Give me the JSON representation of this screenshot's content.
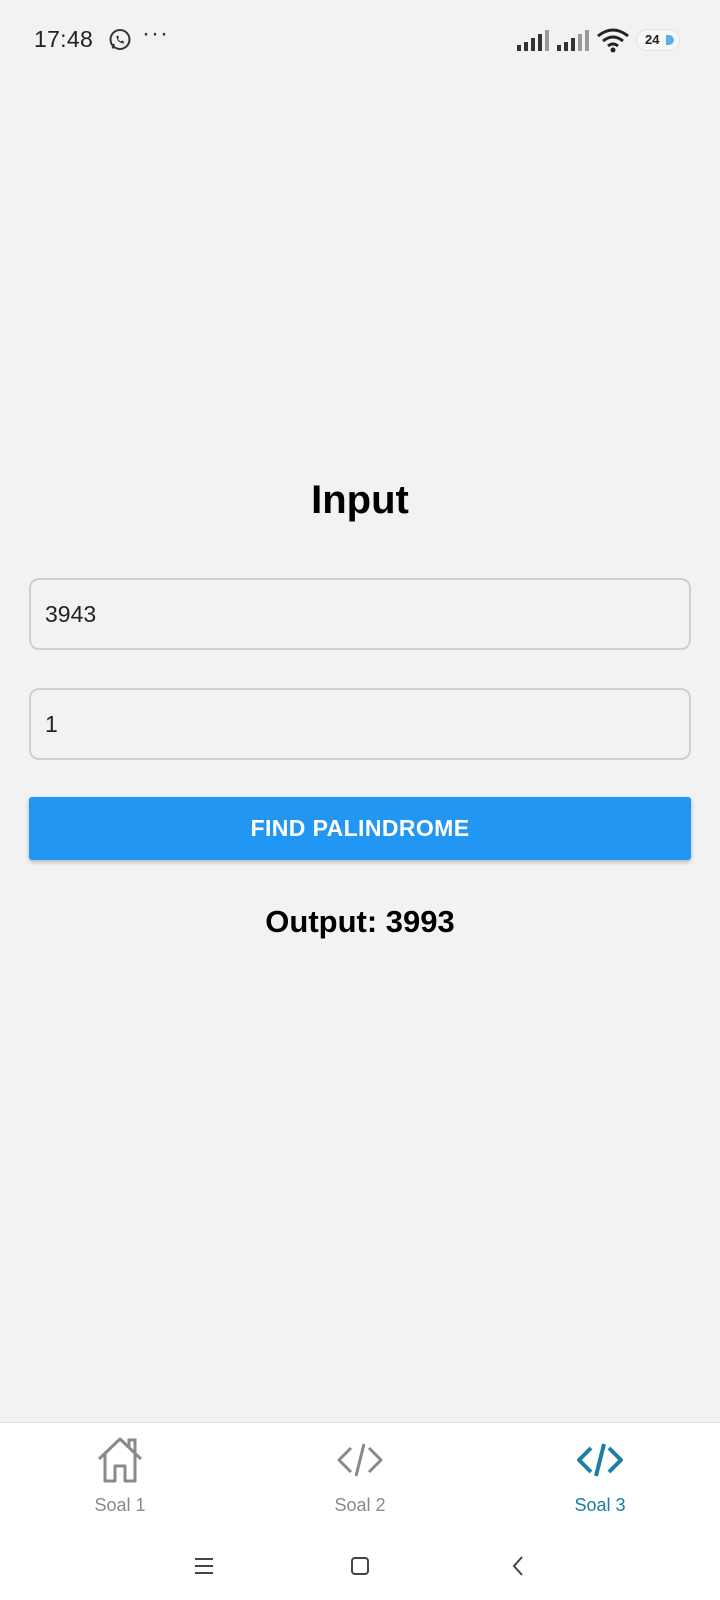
{
  "status_bar": {
    "time": "17:48",
    "more": "···",
    "battery": "24",
    "icons": [
      "whatsapp-icon",
      "signal-icon",
      "signal-icon",
      "wifi-icon",
      "battery-icon"
    ]
  },
  "main": {
    "heading": "Input",
    "input_1_value": "3943",
    "input_2_value": "1",
    "button_label": "FIND PALINDROME",
    "output": "Output: 3993"
  },
  "bottom_nav": {
    "items": [
      {
        "label": "Soal 1",
        "icon": "home-icon",
        "active": false
      },
      {
        "label": "Soal 2",
        "icon": "code-icon",
        "active": false
      },
      {
        "label": "Soal 3",
        "icon": "code-icon",
        "active": true
      }
    ]
  },
  "system_nav": [
    "menu-icon",
    "home-square-icon",
    "back-icon"
  ],
  "colors": {
    "background": "#f2f2f2",
    "button": "#2196f3",
    "active_tab": "#1a7fa0",
    "inactive_tab": "#8a8a8a"
  }
}
